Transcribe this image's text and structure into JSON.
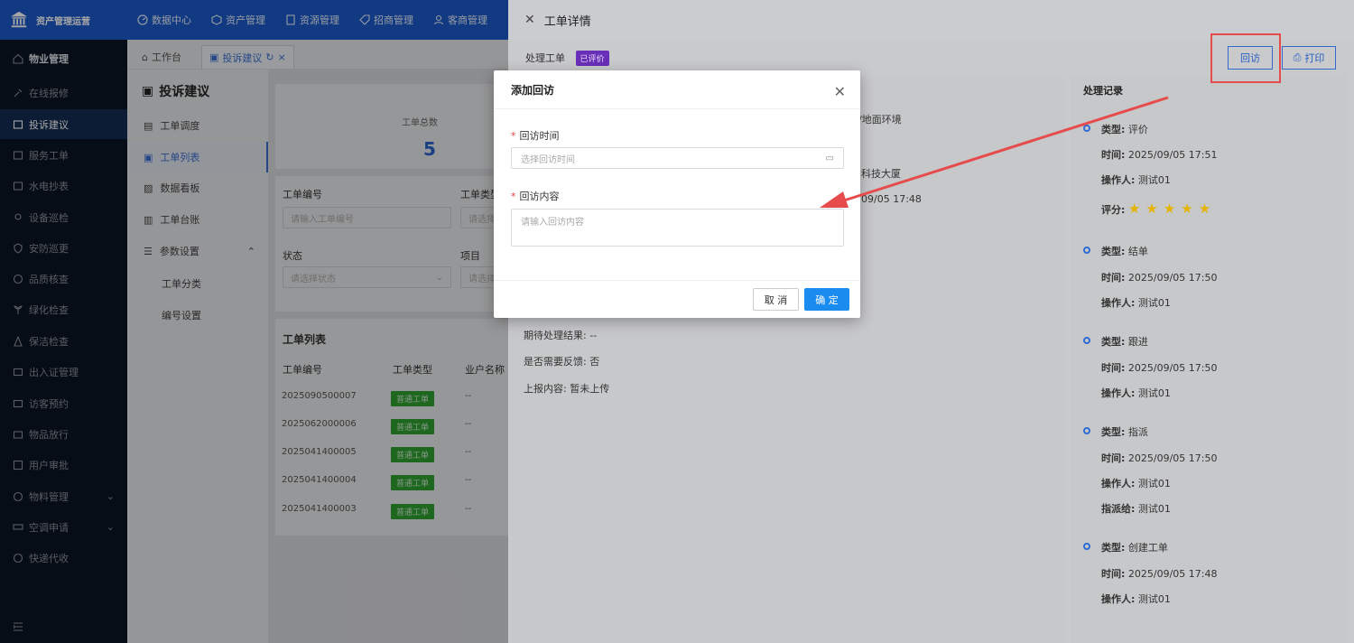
{
  "app": {
    "title": "资产管理运营"
  },
  "topnav": [
    {
      "label": "数据中心",
      "icon": "dashboard-icon"
    },
    {
      "label": "资产管理",
      "icon": "cube-icon"
    },
    {
      "label": "资源管理",
      "icon": "document-icon"
    },
    {
      "label": "招商管理",
      "icon": "tag-icon"
    },
    {
      "label": "客商管理",
      "icon": "users-icon"
    }
  ],
  "sidebar": {
    "items": [
      {
        "label": "物业管理"
      },
      {
        "label": "在线报修"
      },
      {
        "label": "投诉建议"
      },
      {
        "label": "服务工单"
      },
      {
        "label": "水电抄表"
      },
      {
        "label": "设备巡检"
      },
      {
        "label": "安防巡更"
      },
      {
        "label": "品质核查"
      },
      {
        "label": "绿化检查"
      },
      {
        "label": "保洁检查"
      },
      {
        "label": "出入证管理"
      },
      {
        "label": "访客预约"
      },
      {
        "label": "物品放行"
      },
      {
        "label": "用户审批"
      },
      {
        "label": "物料管理"
      },
      {
        "label": "空调申请"
      },
      {
        "label": "快递代收"
      }
    ]
  },
  "tabs": [
    {
      "label": "工作台"
    },
    {
      "label": "投诉建议"
    }
  ],
  "submenu": {
    "title": "投诉建议",
    "items": [
      {
        "label": "工单调度"
      },
      {
        "label": "工单列表"
      },
      {
        "label": "数据看板"
      },
      {
        "label": "工单台账"
      },
      {
        "label": "参数设置"
      },
      {
        "label": "工单分类"
      },
      {
        "label": "编号设置"
      }
    ]
  },
  "stats": {
    "label": "工单总数",
    "value": "5"
  },
  "filters": {
    "order_no_label": "工单编号",
    "order_no_placeholder": "请输入工单编号",
    "type_label": "工单类型",
    "type_placeholder": "请选择",
    "status_label": "状态",
    "status_placeholder": "请选择状态",
    "project_label": "项目",
    "project_placeholder": "请选择"
  },
  "list": {
    "title": "工单列表",
    "headers": [
      "工单编号",
      "工单类型",
      "业户名称"
    ],
    "rows": [
      {
        "no": "2025090500007",
        "type": "普通工单",
        "owner": "--"
      },
      {
        "no": "2025062000006",
        "type": "普通工单",
        "owner": "--"
      },
      {
        "no": "2025041400005",
        "type": "普通工单",
        "owner": "--"
      },
      {
        "no": "2025041400004",
        "type": "普通工单",
        "owner": "--"
      },
      {
        "no": "2025041400003",
        "type": "普通工单",
        "owner": "--"
      }
    ]
  },
  "drawer": {
    "title": "工单详情",
    "section_label": "处理工单",
    "status_tag": "已评价",
    "revisit_btn": "回访",
    "print_btn": "打印",
    "detail_partial": {
      "category": "类/地面环境",
      "building": "科技大厦",
      "time": "09/05 17:48"
    },
    "fields": [
      {
        "label": "期待处理结果:",
        "value": "--"
      },
      {
        "label": "是否需要反馈:",
        "value": "否"
      },
      {
        "label": "上报内容:",
        "value": "暂未上传"
      }
    ]
  },
  "records": {
    "title": "处理记录",
    "type_label": "类型:",
    "time_label": "时间:",
    "operator_label": "操作人:",
    "rating_label": "评分:",
    "assignee_label": "指派给:",
    "items": [
      {
        "type": "评价",
        "time": "2025/09/05 17:51",
        "operator": "测试01",
        "rating": 5
      },
      {
        "type": "结单",
        "time": "2025/09/05 17:50",
        "operator": "测试01"
      },
      {
        "type": "跟进",
        "time": "2025/09/05 17:50",
        "operator": "测试01"
      },
      {
        "type": "指派",
        "time": "2025/09/05 17:50",
        "operator": "测试01",
        "assignee": "测试01"
      },
      {
        "type": "创建工单",
        "time": "2025/09/05 17:48",
        "operator": "测试01"
      }
    ]
  },
  "modal": {
    "title": "添加回访",
    "time_label": "回访时间",
    "time_placeholder": "选择回访时间",
    "content_label": "回访内容",
    "content_placeholder": "请输入回访内容",
    "cancel": "取 消",
    "ok": "确 定"
  },
  "colors": {
    "primary": "#1a8cf0",
    "topbar": "#1c59c8",
    "sidebar": "#0c1422",
    "annotation": "#e74c4c",
    "tag_purple": "#6a2fb8",
    "tag_green": "#2e9e2e",
    "star": "#e6b400"
  }
}
